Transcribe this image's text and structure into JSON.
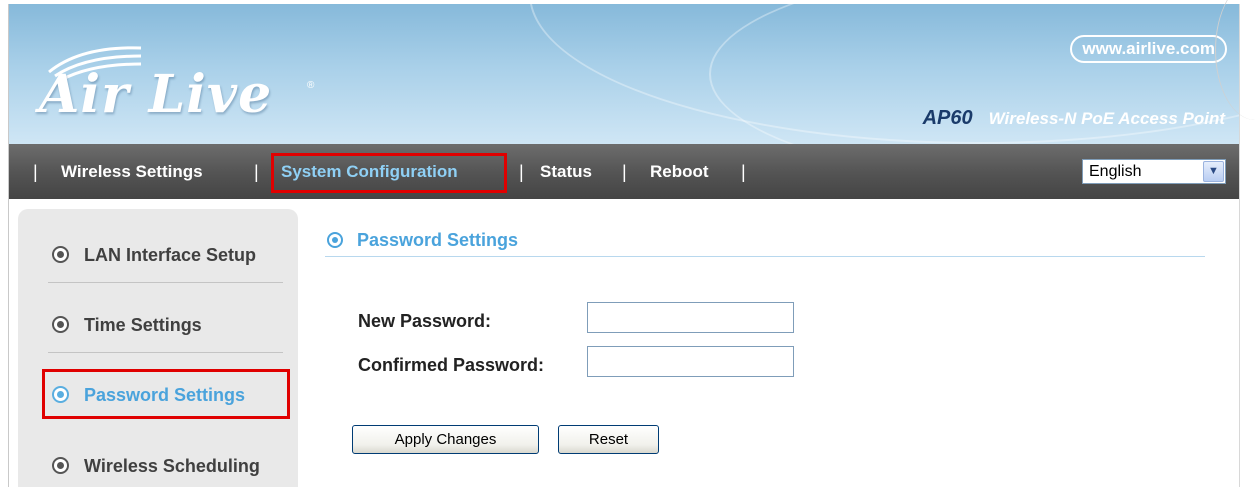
{
  "header": {
    "logo_text": "Air Live",
    "logo_mark": "®",
    "site_url": "www.airlive.com",
    "model_name": "AP60",
    "model_description": "Wireless-N PoE Access Point"
  },
  "navbar": {
    "separator": "|",
    "items": [
      {
        "label": "Wireless Settings"
      },
      {
        "label": "System Configuration",
        "active": true
      },
      {
        "label": "Status"
      },
      {
        "label": "Reboot"
      }
    ],
    "language": {
      "selected": "English",
      "arrow_icon": "chevron-down-icon"
    }
  },
  "sidebar": {
    "items": [
      {
        "label": "LAN Interface Setup"
      },
      {
        "label": "Time Settings"
      },
      {
        "label": "Password Settings",
        "active": true
      },
      {
        "label": "Wireless Scheduling"
      }
    ]
  },
  "main": {
    "title": "Password Settings",
    "fields": [
      {
        "label": "New Password:",
        "value": ""
      },
      {
        "label": "Confirmed Password:",
        "value": ""
      }
    ],
    "buttons": {
      "apply": "Apply Changes",
      "reset": "Reset"
    }
  },
  "colors": {
    "accent": "#4aa3dc",
    "highlight_box": "#e00000",
    "navbar": "#555555",
    "header": "#a9d0e9"
  }
}
